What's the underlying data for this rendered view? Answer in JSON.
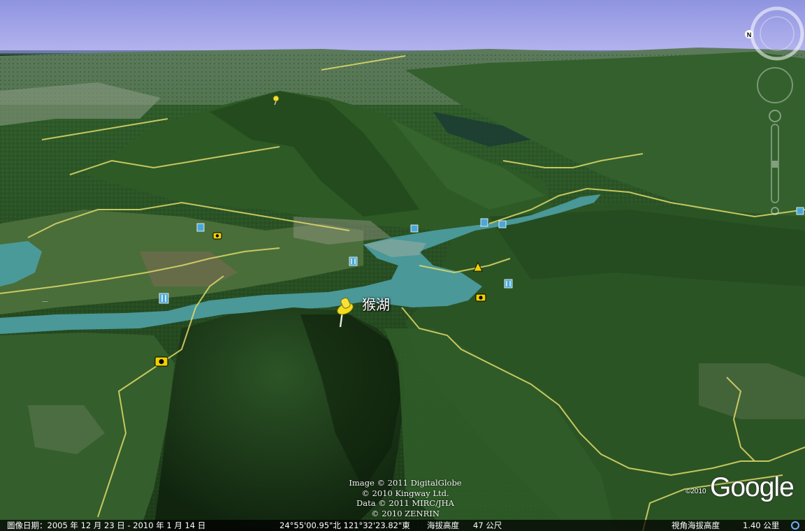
{
  "placemark": {
    "label": "猴湖",
    "icon": "yellow-pushpin-icon"
  },
  "map_icons": {
    "camera": "camera-icon",
    "restaurant": "restaurant-icon",
    "cafe": "cafe-icon",
    "pin": "pushpin-icon"
  },
  "attribution": {
    "line1": "Image © 2011 DigitalGlobe",
    "line2": "© 2010 Kingway Ltd.",
    "line3": "Data © 2011 MIRC/JHA",
    "line4": "© 2010 ZENRIN"
  },
  "logo": {
    "text": "Google",
    "year": "©2010"
  },
  "status": {
    "imagery_date": "圖像日期：2005 年 12 月 23 日 - 2010 年 1 月 14 日",
    "coordinates": "24°55'00.95\"北   121°32'23.82\"東",
    "elevation_label": "海拔高度",
    "elevation_value": "47 公尺",
    "eye_alt_label": "視角海拔高度",
    "eye_alt_value": "1.40 公里"
  },
  "navigation": {
    "compass_north": "N",
    "look_ring": "look-joystick-icon",
    "move_ring": "move-joystick-icon",
    "zoom": "zoom-slider-icon"
  },
  "colors": {
    "sky": "#9a9ee6",
    "forest": "#2f5a2c",
    "river": "#4a9a9a",
    "road": "#e8e070",
    "status_bar": "#000000"
  }
}
